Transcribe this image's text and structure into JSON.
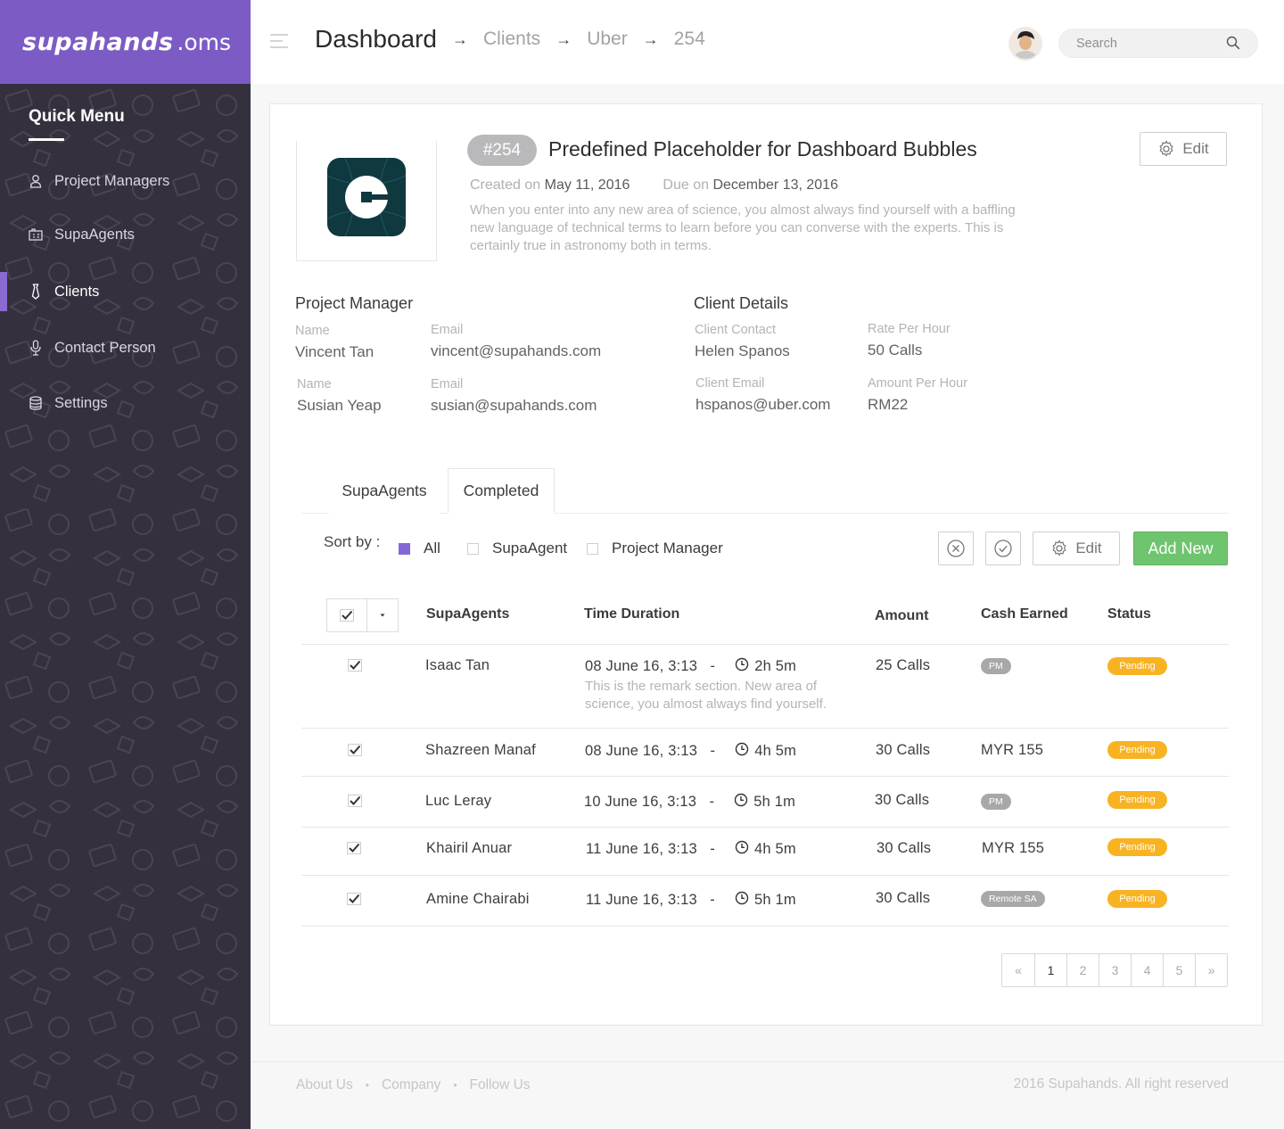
{
  "brand": {
    "name": "supahands",
    "suffix": ".oms"
  },
  "sidebar": {
    "heading": "Quick Menu",
    "items": [
      {
        "label": "Project Managers",
        "icon": "user-icon",
        "active": false
      },
      {
        "label": "SupaAgents",
        "icon": "agents-icon",
        "active": false
      },
      {
        "label": "Clients",
        "icon": "tie-icon",
        "active": true
      },
      {
        "label": "Contact Person",
        "icon": "microphone-icon",
        "active": false
      },
      {
        "label": "Settings",
        "icon": "database-icon",
        "active": false
      }
    ]
  },
  "header": {
    "breadcrumb": [
      "Dashboard",
      "Clients",
      "Uber",
      "254"
    ],
    "search_placeholder": "Search"
  },
  "project": {
    "id": "#254",
    "title": "Predefined Placeholder for Dashboard Bubbles",
    "created_label": "Created on",
    "created_date": "May 11, 2016",
    "due_label": "Due on",
    "due_date": "December 13, 2016",
    "description": "When you enter into any new area of science, you almost always find yourself with a baffling new language of technical terms to learn before you can converse with the experts. This is certainly true in astronomy both in terms.",
    "edit_label": "Edit"
  },
  "project_manager": {
    "title": "Project Manager",
    "name_label": "Name",
    "email_label": "Email",
    "people": [
      {
        "name": "Vincent Tan",
        "email": "vincent@supahands.com"
      },
      {
        "name": "Susian Yeap",
        "email": "susian@supahands.com"
      }
    ]
  },
  "client_details": {
    "title": "Client Details",
    "contact_label": "Client Contact",
    "contact": "Helen Spanos",
    "rate_label": "Rate Per Hour",
    "rate": "50 Calls",
    "email_label": "Client Email",
    "email": "hspanos@uber.com",
    "amount_label": "Amount Per Hour",
    "amount": "RM22"
  },
  "tabs": [
    {
      "label": "SupaAgents",
      "active": false
    },
    {
      "label": "Completed",
      "active": true
    }
  ],
  "sort": {
    "label": "Sort by  :",
    "options": [
      {
        "label": "All",
        "checked": true
      },
      {
        "label": "SupaAgent",
        "checked": false
      },
      {
        "label": "Project Manager",
        "checked": false
      }
    ]
  },
  "toolbar": {
    "edit_label": "Edit",
    "add_new_label": "Add New"
  },
  "table": {
    "columns": [
      "SupaAgents",
      "Time Duration",
      "Amount",
      "Cash Earned",
      "Status"
    ],
    "rows": [
      {
        "agent": "Isaac Tan",
        "date": "08 June 16, 3:13",
        "duration": "2h 5m",
        "amount": "25 Calls",
        "cash_badge": "PM",
        "cash_text": "",
        "status": "Pending",
        "remark": "This is the remark section. New area of science, you almost always find yourself."
      },
      {
        "agent": "Shazreen Manaf",
        "date": "08 June 16, 3:13",
        "duration": "4h 5m",
        "amount": "30 Calls",
        "cash_badge": "",
        "cash_text": "MYR 155",
        "status": "Pending",
        "remark": ""
      },
      {
        "agent": "Luc Leray",
        "date": "10 June 16, 3:13",
        "duration": "5h 1m",
        "amount": "30 Calls",
        "cash_badge": "PM",
        "cash_text": "",
        "status": "Pending",
        "remark": ""
      },
      {
        "agent": "Khairil Anuar",
        "date": "11 June 16, 3:13",
        "duration": "4h 5m",
        "amount": "30 Calls",
        "cash_badge": "",
        "cash_text": "MYR 155",
        "status": "Pending",
        "remark": ""
      },
      {
        "agent": "Amine Chairabi",
        "date": "11 June 16, 3:13",
        "duration": "5h 1m",
        "amount": "30 Calls",
        "cash_badge": "Remote SA",
        "cash_text": "",
        "status": "Pending",
        "remark": ""
      }
    ]
  },
  "pagination": [
    "«",
    "1",
    "2",
    "3",
    "4",
    "5",
    "»"
  ],
  "footer": {
    "links": [
      "About Us",
      "Company",
      "Follow Us"
    ],
    "copyright": "2016 Supahands. All right reserved"
  },
  "colors": {
    "brand_purple": "#7c5cc4",
    "sidebar_dark": "#34303d",
    "add_green": "#6fc46e",
    "pending_orange": "#f8b323",
    "uber_teal": "#10383f"
  }
}
